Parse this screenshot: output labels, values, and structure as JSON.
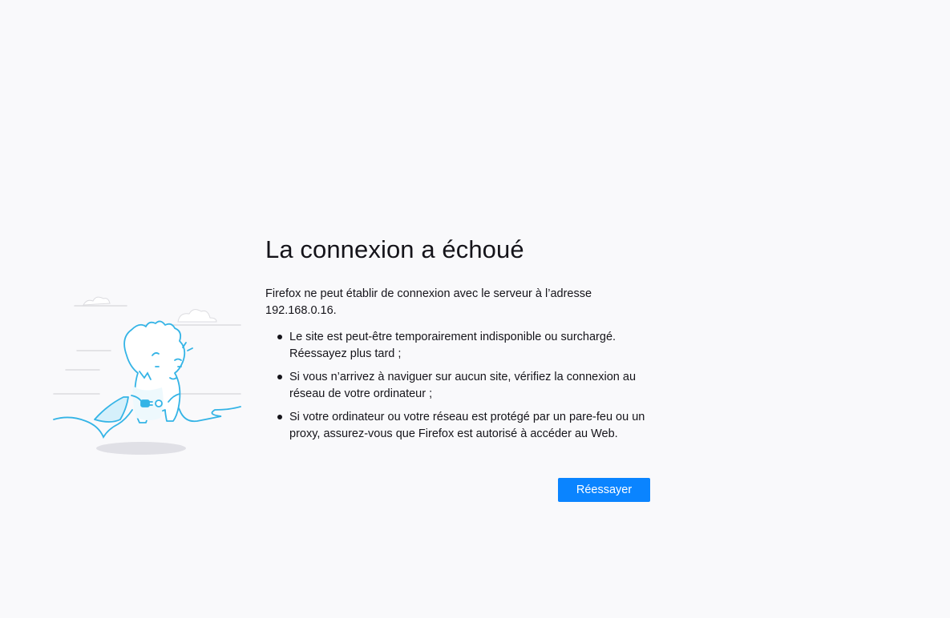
{
  "page": {
    "title": "La connexion a échoué",
    "description": "Firefox ne peut établir de connexion avec le serveur à l’adresse 192.168.0.16.",
    "tips": [
      "Le site est peut-être temporairement indisponible ou surchargé. Réessayez plus tard ;",
      "Si vous n’arrivez à naviguer sur aucun site, vérifiez la connexion au réseau de votre ordinateur ;",
      "Si votre ordinateur ou votre réseau est protégé par un pare-feu ou un proxy, assurez-vous que Firefox est autorisé à accéder au Web."
    ],
    "retry_label": "Réessayer"
  },
  "illustration": {
    "icon": "disconnected-dino-illustration"
  },
  "colors": {
    "background": "#f9f9fb",
    "accent": "#0a84ff",
    "illustration_stroke": "#34b4e6",
    "illustration_fill": "#e6f6fc"
  }
}
